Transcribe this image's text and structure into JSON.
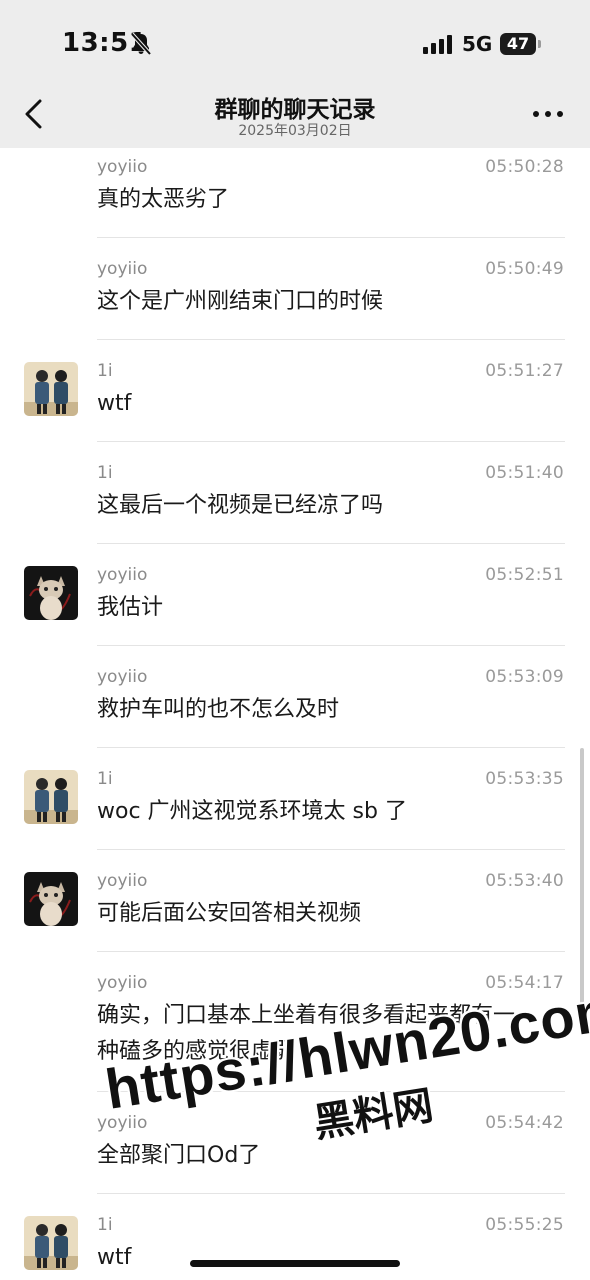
{
  "status_bar": {
    "time": "13:51",
    "network": "5G",
    "battery": "47",
    "icons": [
      "bell-slash-icon",
      "signal-icon",
      "battery-icon"
    ]
  },
  "nav": {
    "title": "群聊的聊天记录",
    "subtitle": "2025年03月02日",
    "back_icon": "chevron-left-icon",
    "more_icon": "more-horizontal-icon"
  },
  "messages": [
    {
      "sender": "yoyiio",
      "time": "05:50:28",
      "text": "真的太恶劣了",
      "avatar": "none"
    },
    {
      "sender": "yoyiio",
      "time": "05:50:49",
      "text": "这个是广州刚结束门口的时候",
      "avatar": "none"
    },
    {
      "sender": "1i",
      "time": "05:51:27",
      "text": "wtf",
      "avatar": "two-people-avatar"
    },
    {
      "sender": "1i",
      "time": "05:51:40",
      "text": "这最后一个视频是已经凉了吗",
      "avatar": "none"
    },
    {
      "sender": "yoyiio",
      "time": "05:52:51",
      "text": "我估计",
      "avatar": "cat-avatar"
    },
    {
      "sender": "yoyiio",
      "time": "05:53:09",
      "text": "救护车叫的也不怎么及时",
      "avatar": "none"
    },
    {
      "sender": "1i",
      "time": "05:53:35",
      "text": "woc 广州这视觉系环境太 sb 了",
      "avatar": "two-people-avatar"
    },
    {
      "sender": "yoyiio",
      "time": "05:53:40",
      "text": "可能后面公安回答相关视频",
      "avatar": "cat-avatar"
    },
    {
      "sender": "yoyiio",
      "time": "05:54:17",
      "text": "确实，门口基本上坐着有很多看起来都有一",
      "text2": "种磕多的感觉很虚弱",
      "avatar": "none"
    },
    {
      "sender": "yoyiio",
      "time": "05:54:42",
      "text": "全部聚门口Od了",
      "avatar": "none"
    },
    {
      "sender": "1i",
      "time": "05:55:25",
      "text": "wtf",
      "avatar": "two-people-avatar"
    }
  ],
  "watermark": {
    "url": "https://hlwn20.com",
    "label": "黑料网"
  }
}
